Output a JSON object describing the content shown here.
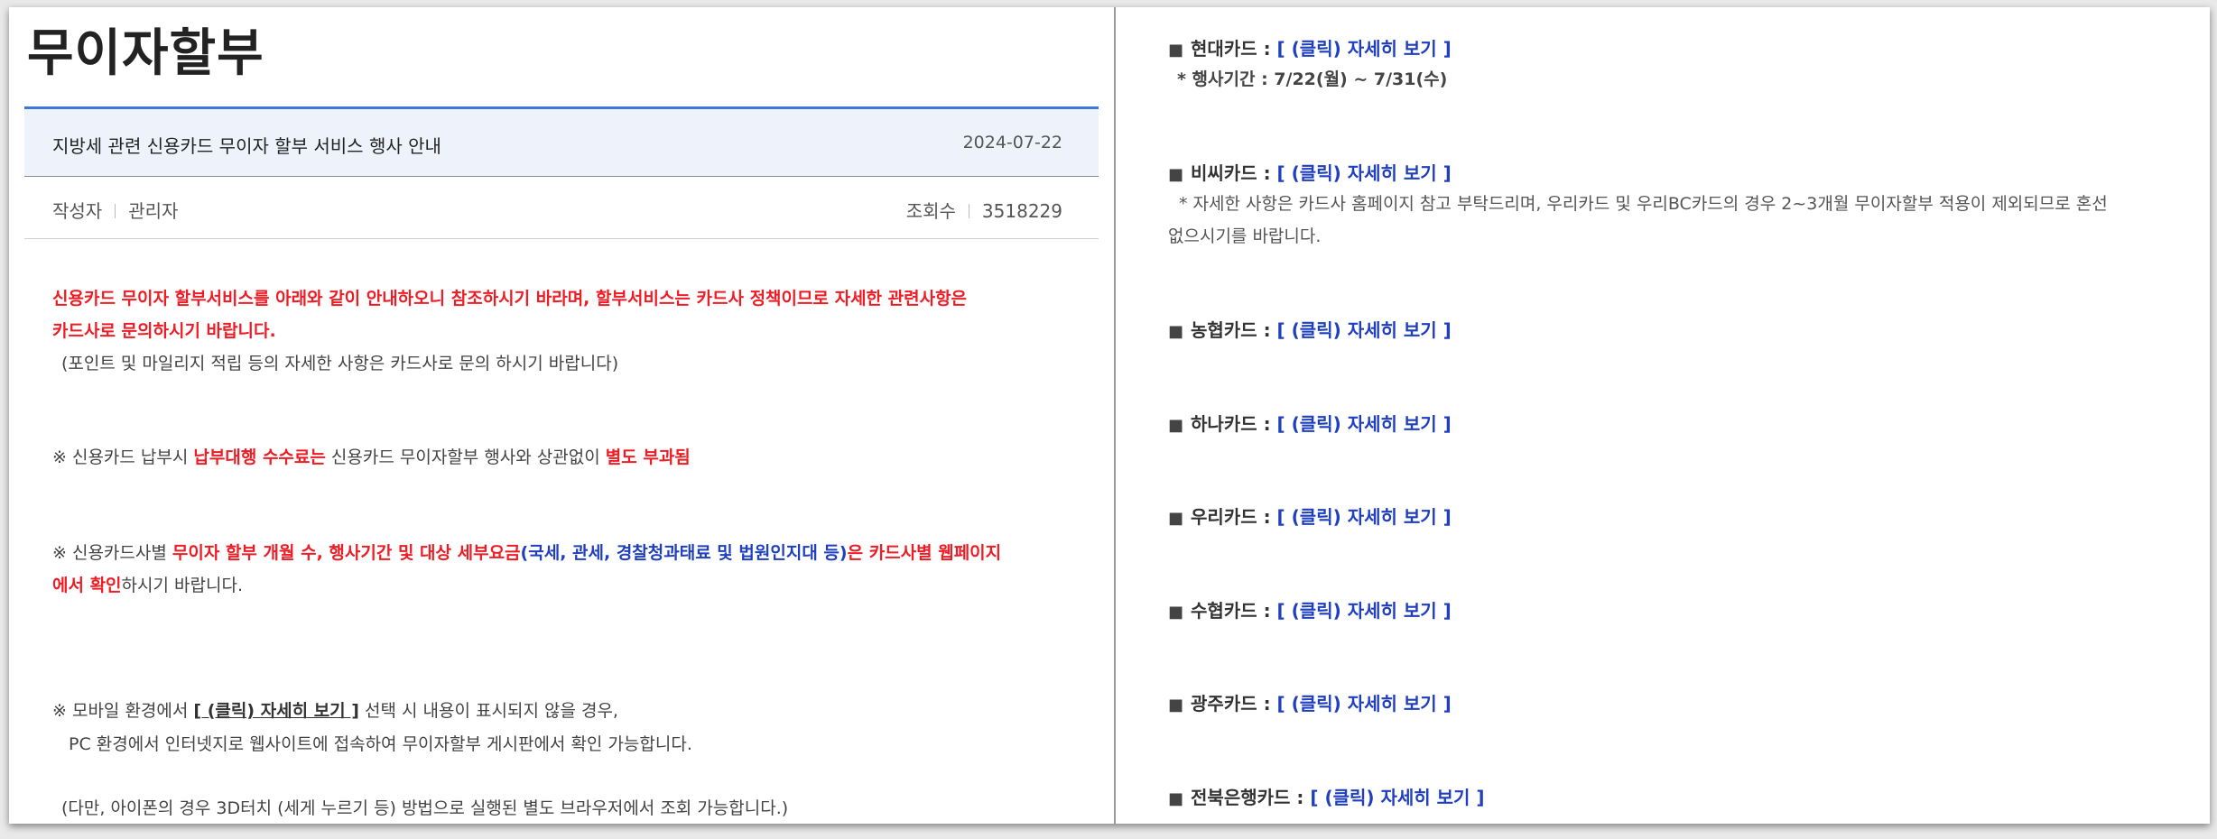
{
  "page_title": "무이자할부",
  "post": {
    "subject": "지방세 관련 신용카드 무이자 할부 서비스 행사 안내",
    "date": "2024-07-22",
    "author_label": "작성자",
    "author": "관리자",
    "views_label": "조회수",
    "views": "3518229"
  },
  "body": {
    "intro_red_1": "신용카드 무이자 할부서비스를 아래와 같이 안내하오니 참조하시기 바라며, 할부서비스는 카드사 정책이므로 자세한 관련사항은",
    "intro_red_2": "카드사로 문의하시기 바랍니다.",
    "intro_note": "(포인트 및 마일리지 적립 등의 자세한 사항은 카드사로 문의 하시기 바랍니다)",
    "fee_prefix": "※ 신용카드 납부시 ",
    "fee_red_1": "납부대행 수수료는",
    "fee_mid": " 신용카드 무이자할부 행사와 상관없이 ",
    "fee_red_2": "별도 부과됨",
    "check_prefix": "※ 신용카드사별 ",
    "check_red_1": "무이자 할부 개월 수, 행사기간 및 대상 세부요금",
    "check_blue": "(국세, 관세, 경찰청과태료 및 법원인지대 등)",
    "check_red_2": "은 카드사별 웹페이지",
    "check_red_3": "에서 확인",
    "check_suffix": "하시기 바랍니다.",
    "mobile_prefix": "※ 모바일 환경에서 ",
    "mobile_link": "[ (클릭) 자세히 보기 ]",
    "mobile_suffix": " 선택 시 내용이 표시되지 않을 경우,",
    "mobile_line2": "PC 환경에서 인터넷지로 웹사이트에 접속하여 무이자할부 게시판에서 확인 가능합니다.",
    "iphone_note": "(다만, 아이폰의 경우 3D터치 (세게 누르기 등) 방법으로 실행된 별도 브라우저에서 조회 가능합니다.)"
  },
  "cards": [
    {
      "name": "현대카드 : ",
      "link": "[ (클릭) 자세히 보기 ]",
      "note": "* 행사기간 : 7/22(월) ~ 7/31(수)"
    },
    {
      "name": "비씨카드 : ",
      "link": "[ (클릭) 자세히 보기 ]",
      "note_1": "* 자세한 사항은 카드사 홈페이지 참고 부탁드리며, 우리카드 및 우리BC카드의 경우 2~3개월 무이자할부 적용이 제외되므로 혼선",
      "note_2": "없으시기를 바랍니다."
    },
    {
      "name": "농협카드 : ",
      "link": "[ (클릭) 자세히 보기 ]"
    },
    {
      "name": "하나카드 :  ",
      "link": "[ (클릭) 자세히 보기 ]"
    },
    {
      "name": "우리카드 : ",
      "link": "[ (클릭) 자세히 보기 ]"
    },
    {
      "name": "수협카드 : ",
      "link": "[ (클릭) 자세히 보기 ]"
    },
    {
      "name": "광주카드 : ",
      "link": "[ (클릭) 자세히 보기 ]"
    },
    {
      "name": "전북은행카드 : ",
      "link": "[ (클릭) 자세히 보기 ]"
    }
  ],
  "bullet_glyph": "■",
  "colors": {
    "accent_line": "#3a79d8",
    "header_bg": "#eef3fb",
    "red_text": "#ee1c25",
    "blue_link": "#1f3fbf"
  }
}
